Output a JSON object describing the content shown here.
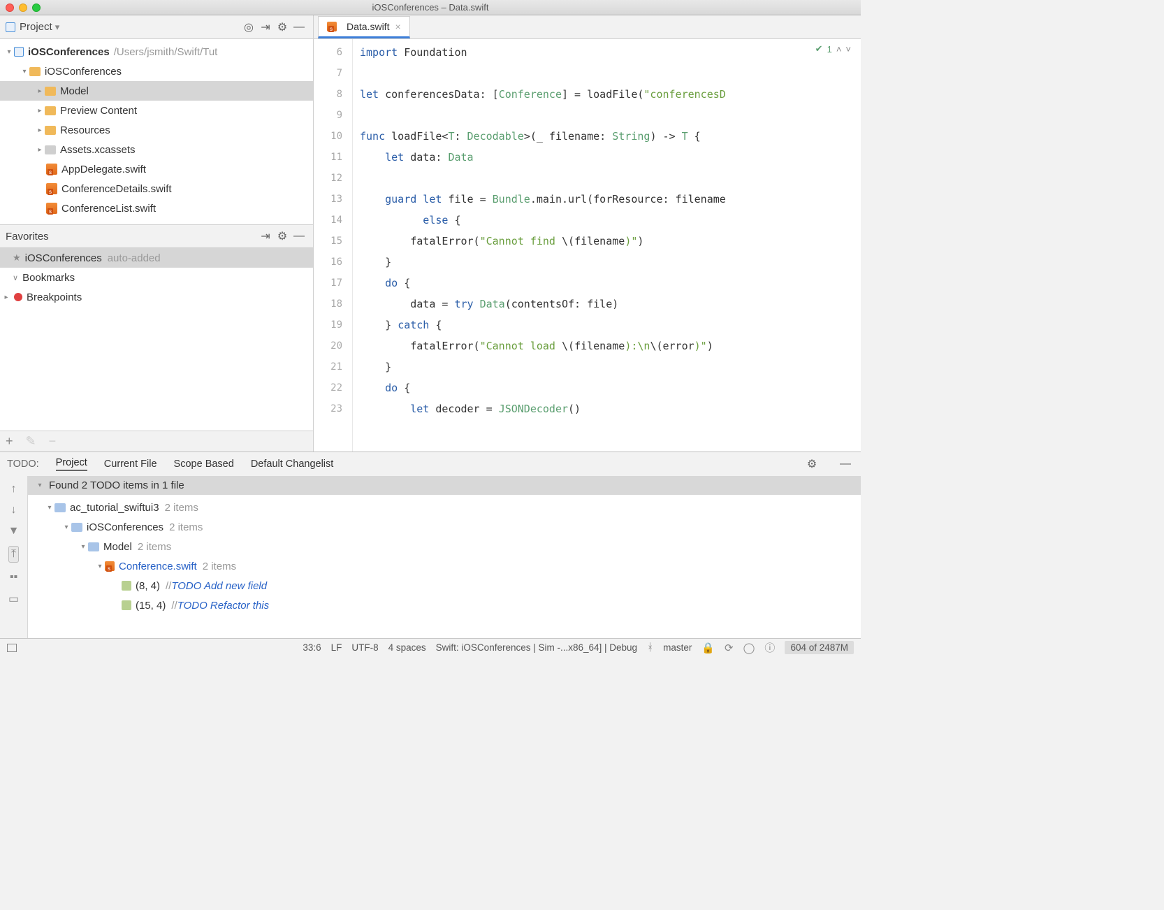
{
  "titlebar": {
    "title": "iOSConferences – Data.swift"
  },
  "projectHeader": {
    "label": "Project"
  },
  "tree": {
    "root": {
      "name": "iOSConferences",
      "path": "/Users/jsmith/Swift/Tut"
    },
    "items": [
      {
        "name": "iOSConferences",
        "kind": "folder",
        "expanded": true
      },
      {
        "name": "Model",
        "kind": "folder",
        "selected": true
      },
      {
        "name": "Preview Content",
        "kind": "folder"
      },
      {
        "name": "Resources",
        "kind": "folder"
      },
      {
        "name": "Assets.xcassets",
        "kind": "assets"
      },
      {
        "name": "AppDelegate.swift",
        "kind": "swift"
      },
      {
        "name": "ConferenceDetails.swift",
        "kind": "swift"
      },
      {
        "name": "ConferenceList.swift",
        "kind": "swift"
      }
    ]
  },
  "favorites": {
    "label": "Favorites",
    "items": [
      {
        "name": "iOSConferences",
        "note": "auto-added",
        "icon": "star",
        "selected": true
      },
      {
        "name": "Bookmarks",
        "icon": "bm"
      },
      {
        "name": "Breakpoints",
        "icon": "bp",
        "arrow": true
      }
    ]
  },
  "tab": {
    "name": "Data.swift"
  },
  "gutter": [
    "6",
    "7",
    "8",
    "9",
    "10",
    "11",
    "12",
    "13",
    "14",
    "15",
    "16",
    "17",
    "18",
    "19",
    "20",
    "21",
    "22",
    "23"
  ],
  "editorMarks": {
    "count": "1"
  },
  "code": {
    "l6a": "import",
    "l6b": " Foundation",
    "l8a": "let",
    "l8b": " conferencesData: [",
    "l8c": "Conference",
    "l8d": "] = loadFile(",
    "l8e": "\"conferencesD",
    "l10a": "func",
    "l10b": " loadFile<",
    "l10c": "T",
    "l10d": ": ",
    "l10e": "Decodable",
    "l10f": ">(_ filename: ",
    "l10g": "String",
    "l10h": ") -> ",
    "l10i": "T",
    "l10j": " {",
    "l11a": "    let",
    "l11b": " data: ",
    "l11c": "Data",
    "l13a": "    guard let",
    "l13b": " file = ",
    "l13c": "Bundle",
    "l13d": ".main.url(forResource: filename",
    "l14a": "          else",
    "l14b": " {",
    "l15a": "        fatalError(",
    "l15b": "\"Cannot find ",
    "l15c": "\\(",
    "l15d": "filename",
    "l15e": ")\"",
    "l15f": ")",
    "l16": "    }",
    "l17a": "    do",
    "l17b": " {",
    "l18a": "        data = ",
    "l18b": "try",
    "l18c": " Data",
    "l18d": "(contentsOf: file)",
    "l19a": "    } ",
    "l19b": "catch",
    "l19c": " {",
    "l20a": "        fatalError(",
    "l20b": "\"Cannot load ",
    "l20c": "\\(",
    "l20d": "filename",
    "l20e": ")",
    "l20f": ":\\n",
    "l20g": "\\(",
    "l20h": "error",
    "l20i": ")\"",
    "l20j": ")",
    "l21": "    }",
    "l22a": "    do",
    "l22b": " {",
    "l23a": "        let",
    "l23b": " decoder = ",
    "l23c": "JSONDecoder",
    "l23d": "()"
  },
  "todo": {
    "label": "TODO:",
    "tabs": [
      "Project",
      "Current File",
      "Scope Based",
      "Default Changelist"
    ],
    "activeTab": 0,
    "summary": "Found 2 TODO items in 1 file",
    "rows": [
      {
        "indent": 1,
        "name": "ac_tutorial_swiftui3",
        "count": "2 items",
        "kind": "folder"
      },
      {
        "indent": 2,
        "name": "iOSConferences",
        "count": "2 items",
        "kind": "folder"
      },
      {
        "indent": 3,
        "name": "Model",
        "count": "2 items",
        "kind": "folder"
      },
      {
        "indent": 4,
        "name": "Conference.swift",
        "count": "2 items",
        "kind": "swift",
        "link": true
      },
      {
        "indent": 5,
        "loc": "(8, 4)",
        "sep": " // ",
        "comment": "TODO Add new field",
        "kind": "line"
      },
      {
        "indent": 5,
        "loc": "(15, 4)",
        "sep": " // ",
        "comment": "TODO Refactor this",
        "kind": "line"
      }
    ]
  },
  "status": {
    "pos": "33:6",
    "lf": "LF",
    "enc": "UTF-8",
    "indent": "4 spaces",
    "target": "Swift: iOSConferences | Sim -...x86_64] | Debug",
    "branch": "master",
    "mem": "604 of 2487M"
  }
}
